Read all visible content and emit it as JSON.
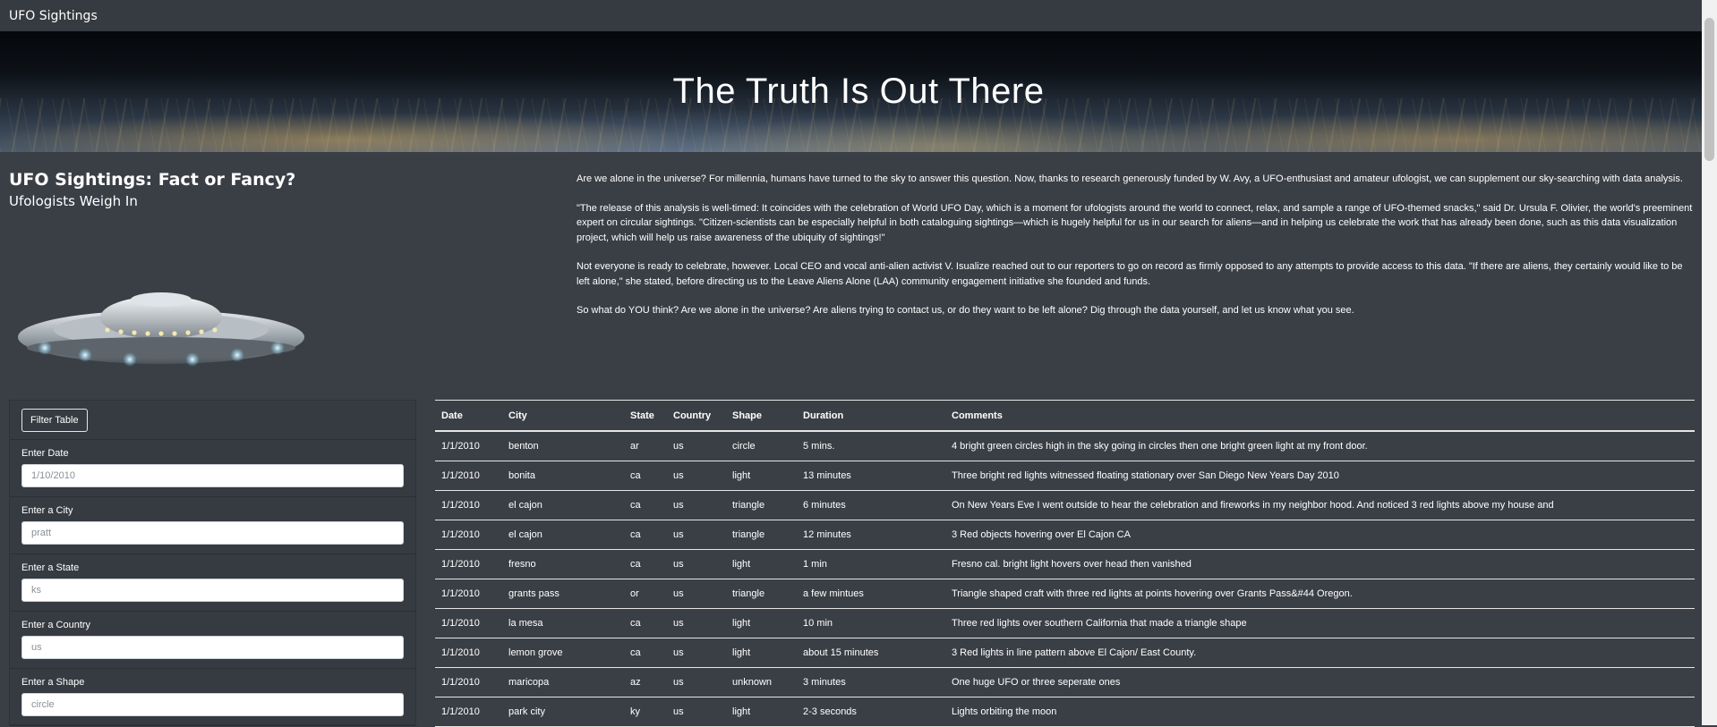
{
  "navbar": {
    "brand": "UFO Sightings"
  },
  "hero": {
    "title": "The Truth Is Out There"
  },
  "intro": {
    "title": "UFO Sightings: Fact or Fancy?",
    "subtitle": "Ufologists Weigh In",
    "paragraphs": [
      "Are we alone in the universe? For millennia, humans have turned to the sky to answer this question. Now, thanks to research generously funded by W. Avy, a UFO-enthusiast and amateur ufologist, we can supplement our sky-searching with data analysis.",
      "\"The release of this analysis is well-timed: It coincides with the celebration of World UFO Day, which is a moment for ufologists around the world to connect, relax, and sample a range of UFO-themed snacks,\" said Dr. Ursula F. Olivier, the world's preeminent expert on circular sightings. \"Citizen-scientists can be especially helpful in both cataloguing sightings—which is hugely helpful for us in our search for aliens—and in helping us celebrate the work that has already been done, such as this data visualization project, which will help us raise awareness of the ubiquity of sightings!\"",
      "Not everyone is ready to celebrate, however. Local CEO and vocal anti-alien activist V. Isualize reached out to our reporters to go on record as firmly opposed to any attempts to provide access to this data. \"If there are aliens, they certainly would like to be left alone,\" she stated, before directing us to the Leave Aliens Alone (LAA) community engagement initiative she founded and funds.",
      "So what do YOU think? Are we alone in the universe? Are aliens trying to contact us, or do they want to be left alone? Dig through the data yourself, and let us know what you see."
    ]
  },
  "filters": {
    "button_label": "Filter Table",
    "fields": [
      {
        "label": "Enter Date",
        "placeholder": "1/10/2010"
      },
      {
        "label": "Enter a City",
        "placeholder": "pratt"
      },
      {
        "label": "Enter a State",
        "placeholder": "ks"
      },
      {
        "label": "Enter a Country",
        "placeholder": "us"
      },
      {
        "label": "Enter a Shape",
        "placeholder": "circle"
      }
    ]
  },
  "table": {
    "headers": [
      "Date",
      "City",
      "State",
      "Country",
      "Shape",
      "Duration",
      "Comments"
    ],
    "rows": [
      [
        "1/1/2010",
        "benton",
        "ar",
        "us",
        "circle",
        "5 mins.",
        "4 bright green circles high in the sky going in circles then one bright green light at my front door."
      ],
      [
        "1/1/2010",
        "bonita",
        "ca",
        "us",
        "light",
        "13 minutes",
        "Three bright red lights witnessed floating stationary over San Diego New Years Day 2010"
      ],
      [
        "1/1/2010",
        "el cajon",
        "ca",
        "us",
        "triangle",
        "6 minutes",
        "On New Years Eve I went outside to hear the celebration and fireworks in my neighbor hood. And noticed 3 red lights above my house and"
      ],
      [
        "1/1/2010",
        "el cajon",
        "ca",
        "us",
        "triangle",
        "12 minutes",
        "3 Red objects hovering over El Cajon CA"
      ],
      [
        "1/1/2010",
        "fresno",
        "ca",
        "us",
        "light",
        "1 min",
        "Fresno cal. bright light hovers over head then vanished"
      ],
      [
        "1/1/2010",
        "grants pass",
        "or",
        "us",
        "triangle",
        "a few mintues",
        "Triangle shaped craft with three red lights at points hovering over Grants Pass&#44 Oregon."
      ],
      [
        "1/1/2010",
        "la mesa",
        "ca",
        "us",
        "light",
        "10 min",
        "Three red lights over southern California that made a triangle shape"
      ],
      [
        "1/1/2010",
        "lemon grove",
        "ca",
        "us",
        "light",
        "about 15 minutes",
        "3 Red lights in line pattern above El Cajon/ East County."
      ],
      [
        "1/1/2010",
        "maricopa",
        "az",
        "us",
        "unknown",
        "3 minutes",
        "One huge UFO or three seperate ones"
      ],
      [
        "1/1/2010",
        "park city",
        "ky",
        "us",
        "light",
        "2-3 seconds",
        "Lights orbiting the moon"
      ]
    ]
  }
}
